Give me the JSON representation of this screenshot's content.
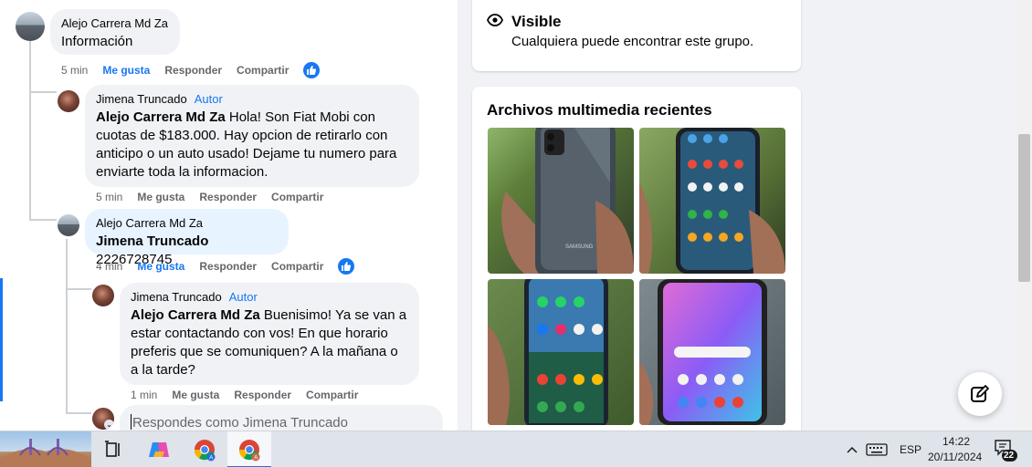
{
  "comments": [
    {
      "author": "Alejo Carrera Md Za",
      "text": "Información",
      "time": "5 min",
      "like": "Me gusta",
      "reply": "Responder",
      "share": "Compartir"
    },
    {
      "author": "Jimena Truncado",
      "badge": "Autor",
      "mention": "Alejo Carrera Md Za",
      "text": " Hola! Son Fiat Mobi con cuotas de $183.000. Hay opcion de retirarlo con anticipo o un auto usado! Dejame tu numero para enviarte toda la informacion.",
      "time": "5 min",
      "like": "Me gusta",
      "reply": "Responder",
      "share": "Compartir"
    },
    {
      "author": "Alejo Carrera Md Za",
      "mention": "Jimena Truncado",
      "text": " 2226728745",
      "time": "4 min",
      "like": "Me gusta",
      "reply": "Responder",
      "share": "Compartir"
    },
    {
      "author": "Jimena Truncado",
      "badge": "Autor",
      "mention": "Alejo Carrera Md Za",
      "text": " Buenisimo! Ya se van a estar contactando con vos! En que horario preferis que se comuniquen? A la mañana o a la tarde?",
      "time": "1 min",
      "like": "Me gusta",
      "reply": "Responder",
      "share": "Compartir"
    }
  ],
  "reply_box": {
    "placeholder": "Respondes como Jimena Truncado"
  },
  "sidebar": {
    "visible_title": "Visible",
    "visible_desc": "Cualquiera puede encontrar este grupo.",
    "media_title": "Archivos multimedia recientes",
    "phone_brand_text": "SAMSUNG"
  },
  "taskbar": {
    "language": "ESP",
    "time": "14:22",
    "date": "20/11/2024",
    "notifications": "22"
  },
  "colors": {
    "accent": "#1877f2",
    "bubble_blue": "#e7f3ff",
    "bubble_gray": "#f0f2f5",
    "secondary_text": "#65676b"
  }
}
